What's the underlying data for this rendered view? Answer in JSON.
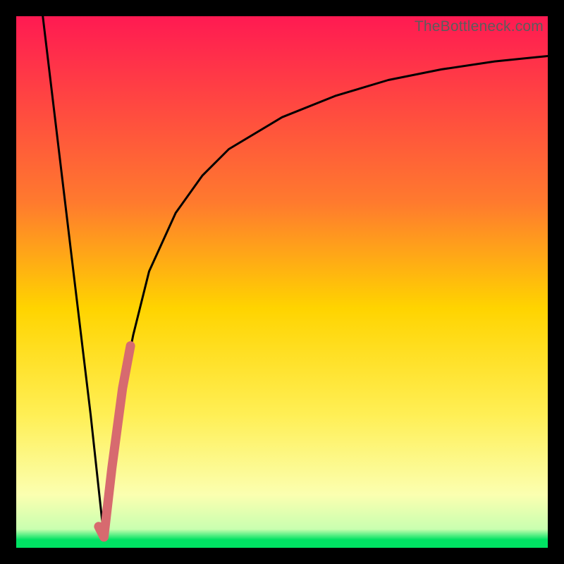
{
  "watermark": "TheBottleneck.com",
  "colors": {
    "frame": "#000000",
    "gradient_top": "#ff1a52",
    "gradient_mid1": "#ff7a2e",
    "gradient_mid2": "#ffd400",
    "gradient_mid3": "#ffef55",
    "gradient_pale": "#fbffb0",
    "gradient_green": "#00e263",
    "curve_stroke": "#000000",
    "highlight_stroke": "#d76a6f"
  },
  "chart_data": {
    "type": "line",
    "title": "",
    "xlabel": "",
    "ylabel": "",
    "xlim": [
      0,
      100
    ],
    "ylim": [
      0,
      100
    ],
    "series": [
      {
        "name": "left-branch",
        "x": [
          5,
          8,
          11,
          14,
          16.5
        ],
        "values": [
          100,
          75,
          50,
          25,
          2
        ]
      },
      {
        "name": "right-branch",
        "x": [
          16.5,
          18,
          20,
          22,
          25,
          30,
          35,
          40,
          50,
          60,
          70,
          80,
          90,
          100
        ],
        "values": [
          2,
          15,
          30,
          40,
          52,
          63,
          70,
          75,
          81,
          85,
          88,
          90,
          91.5,
          92.5
        ]
      },
      {
        "name": "highlight-segment",
        "x": [
          15.5,
          16.5,
          18,
          20,
          21.5
        ],
        "values": [
          4,
          2,
          15,
          30,
          38
        ]
      }
    ],
    "gradient_stops": [
      {
        "pos": 0.0,
        "color": "#ff1a52"
      },
      {
        "pos": 0.35,
        "color": "#ff7a2e"
      },
      {
        "pos": 0.55,
        "color": "#ffd400"
      },
      {
        "pos": 0.75,
        "color": "#ffef55"
      },
      {
        "pos": 0.9,
        "color": "#fbffb0"
      },
      {
        "pos": 0.965,
        "color": "#c9ffb0"
      },
      {
        "pos": 0.985,
        "color": "#00e263"
      },
      {
        "pos": 1.0,
        "color": "#00e263"
      }
    ]
  }
}
